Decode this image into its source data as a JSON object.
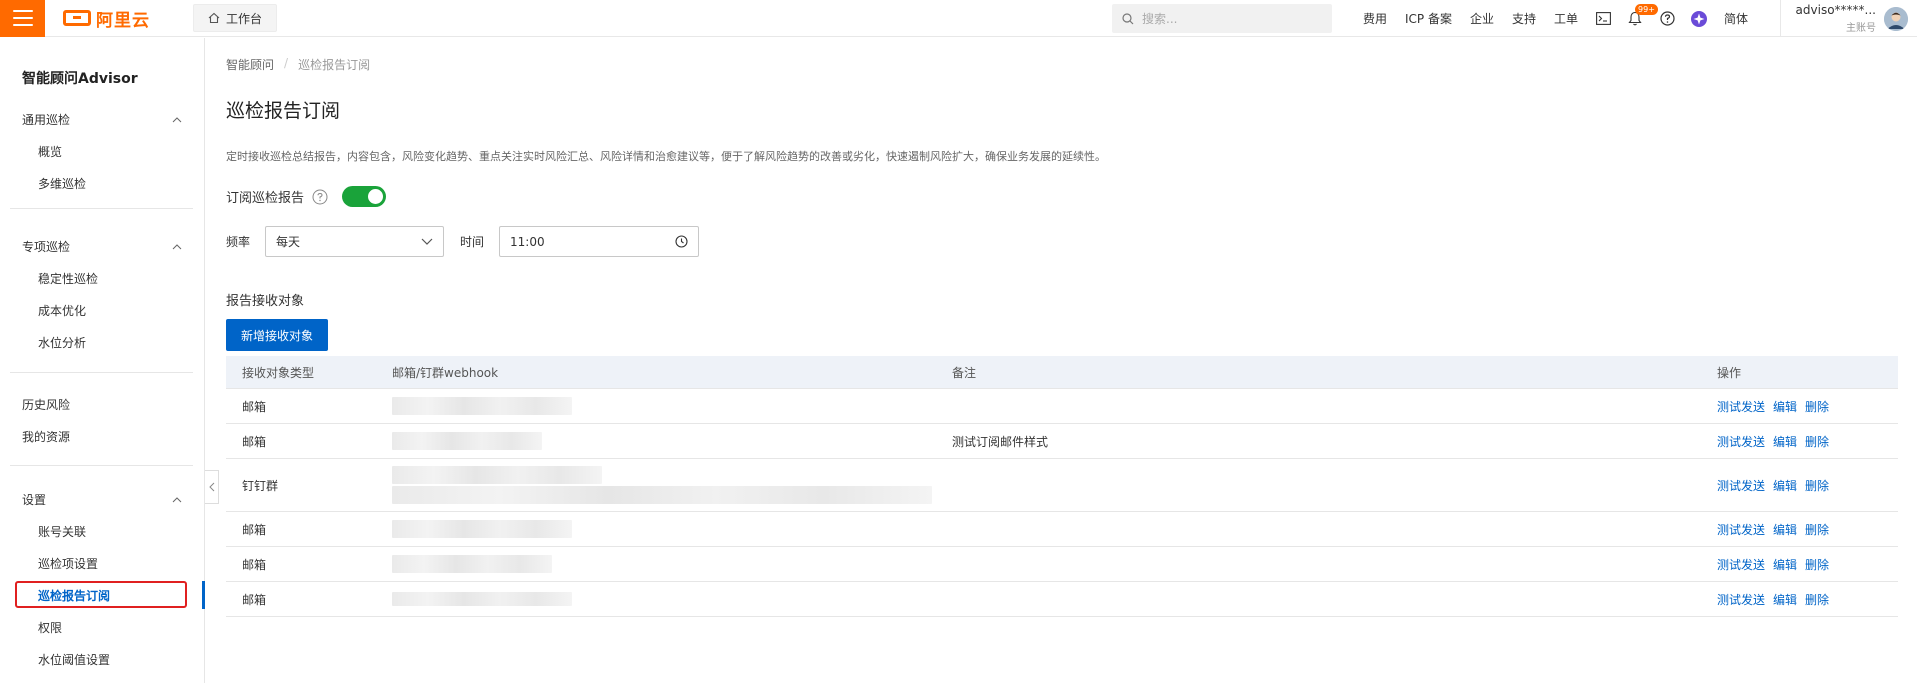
{
  "topbar": {
    "logo_text": "阿里云",
    "workbench_label": "工作台",
    "search_placeholder": "搜索...",
    "nav_links": [
      "费用",
      "ICP 备案",
      "企业",
      "支持",
      "工单"
    ],
    "notification_badge": "99+",
    "language": "简体",
    "account_name": "adviso*****...",
    "account_role": "主账号",
    "brand_color": "#ff6a00"
  },
  "sidebar": {
    "title": "智能顾问Advisor",
    "group1": {
      "label": "通用巡检",
      "items": [
        "概览",
        "多维巡检"
      ]
    },
    "group2": {
      "label": "专项巡检",
      "items": [
        "稳定性巡检",
        "成本优化",
        "水位分析"
      ]
    },
    "plain": [
      "历史风险",
      "我的资源"
    ],
    "group3": {
      "label": "设置",
      "items": [
        "账号关联",
        "巡检项设置",
        "巡检报告订阅",
        "权限",
        "水位阈值设置"
      ]
    },
    "active_item": "巡检报告订阅"
  },
  "main": {
    "breadcrumb": [
      "智能顾问",
      "巡检报告订阅"
    ],
    "title": "巡检报告订阅",
    "description": "定时接收巡检总结报告，内容包含，风险变化趋势、重点关注实时风险汇总、风险详情和治愈建议等，便于了解风险趋势的改善或劣化，快速遏制风险扩大，确保业务发展的延续性。",
    "subscribe_label": "订阅巡检报告",
    "subscribe_enabled": true,
    "frequency_label": "频率",
    "frequency_value": "每天",
    "time_label": "时间",
    "time_value": "11:00",
    "recipients_title": "报告接收对象",
    "add_button": "新增接收对象",
    "accent_color": "#0064c8",
    "toggle_color": "#1aa33a"
  },
  "table": {
    "headers": [
      "接收对象类型",
      "邮箱/钉群webhook",
      "备注",
      "操作"
    ],
    "rows": [
      {
        "type": "邮箱",
        "note": ""
      },
      {
        "type": "邮箱",
        "note": "测试订阅邮件样式"
      },
      {
        "type": "钉钉群",
        "note": ""
      },
      {
        "type": "邮箱",
        "note": ""
      },
      {
        "type": "邮箱",
        "note": ""
      },
      {
        "type": "邮箱",
        "note": ""
      }
    ],
    "actions": [
      "测试发送",
      "编辑",
      "删除"
    ]
  }
}
